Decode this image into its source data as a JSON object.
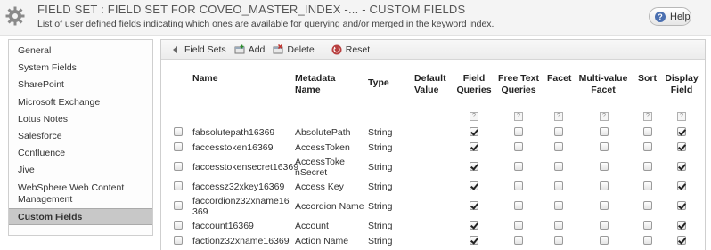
{
  "header": {
    "title": "FIELD SET : FIELD SET FOR COVEO_MASTER_INDEX -... - CUSTOM FIELDS",
    "subtitle": "List of user defined fields indicating which ones are available for querying and/or merged in the keyword index.",
    "help_label": "Help",
    "help_icon": "?",
    "icon": "gear-icon"
  },
  "sidebar": {
    "items": [
      {
        "label": "General"
      },
      {
        "label": "System Fields"
      },
      {
        "label": "SharePoint"
      },
      {
        "label": "Microsoft Exchange"
      },
      {
        "label": "Lotus Notes"
      },
      {
        "label": "Salesforce"
      },
      {
        "label": "Confluence"
      },
      {
        "label": "Jive"
      },
      {
        "label": "WebSphere Web Content Management"
      },
      {
        "label": "Custom Fields",
        "active": true
      }
    ]
  },
  "toolbar": {
    "field_sets": "Field Sets",
    "add": "Add",
    "delete": "Delete",
    "reset": "Reset"
  },
  "table": {
    "columns": {
      "name": "Name",
      "metadata_name": "Metadata Name",
      "type": "Type",
      "default_value": "Default Value",
      "field_queries": "Field Queries",
      "free_text_queries": "Free Text Queries",
      "facet": "Facet",
      "multi_value_facet": "Multi-value Facet",
      "sort": "Sort",
      "display_field": "Display Field"
    },
    "help_marker": "?",
    "rows": [
      {
        "name": "fabsolutepath16369",
        "metadata": "AbsolutePath",
        "type": "String",
        "checks": [
          true,
          false,
          false,
          false,
          false,
          true
        ]
      },
      {
        "name": "faccesstoken16369",
        "metadata": "AccessToken",
        "type": "String",
        "checks": [
          true,
          false,
          false,
          false,
          false,
          true
        ]
      },
      {
        "name": "faccesstokensecret16369",
        "metadata": "AccessTokenSecret",
        "type": "String",
        "checks": [
          true,
          false,
          false,
          false,
          false,
          true
        ]
      },
      {
        "name": "faccessz32xkey16369",
        "metadata": "Access Key",
        "type": "String",
        "checks": [
          true,
          false,
          false,
          false,
          false,
          true
        ]
      },
      {
        "name": "faccordionz32xname16369",
        "metadata": "Accordion Name",
        "type": "String",
        "checks": [
          true,
          false,
          false,
          false,
          false,
          true
        ]
      },
      {
        "name": "faccount16369",
        "metadata": "Account",
        "type": "String",
        "checks": [
          true,
          false,
          false,
          false,
          false,
          true
        ]
      },
      {
        "name": "factionz32xname16369",
        "metadata": "Action Name",
        "type": "String",
        "checks": [
          true,
          false,
          false,
          false,
          false,
          true
        ]
      }
    ]
  }
}
